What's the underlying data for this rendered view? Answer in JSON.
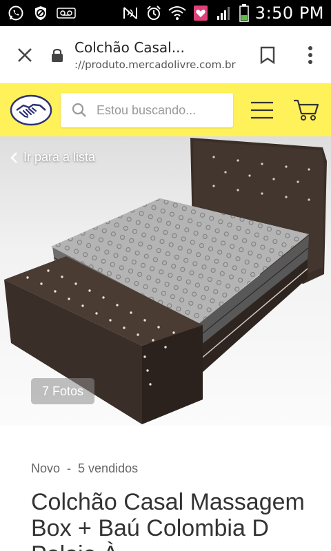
{
  "status_bar": {
    "time": "3:50 PM",
    "icons": [
      "whatsapp-icon",
      "blocked-icon",
      "voicemail-icon",
      "nfc-icon",
      "alarm-icon",
      "wifi-icon",
      "heart-app-icon",
      "signal-icon",
      "battery-icon"
    ]
  },
  "browser": {
    "page_title": "Colchão Casal...",
    "url": "://produto.mercadolivre.com.br"
  },
  "header": {
    "search_placeholder": "Estou buscando...",
    "accent_color": "#fff159"
  },
  "gallery": {
    "back_label": "Ir para a lista",
    "photos_label": "7 Fotos"
  },
  "product": {
    "condition": "Novo",
    "separator": "-",
    "sold": "5 vendidos",
    "title": "Colchão Casal Massagem Box + Baú Colombia D Poloie À"
  }
}
